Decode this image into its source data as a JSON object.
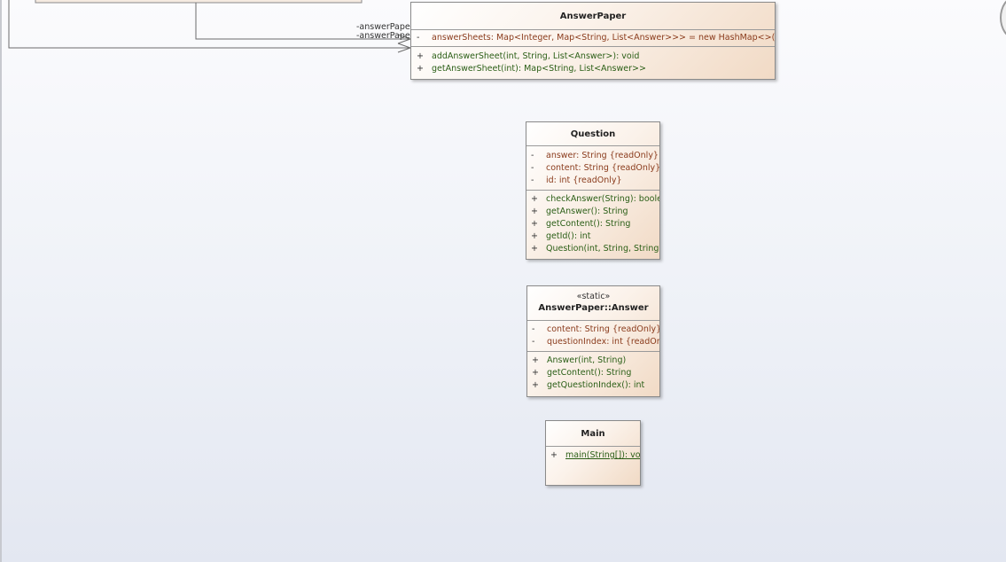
{
  "diagram": {
    "roles": [
      "-answerPaper",
      "-answerPaper"
    ],
    "classes": {
      "answer_paper": {
        "name": "AnswerPaper",
        "attributes": [
          {
            "vis": "-",
            "text": "answerSheets: Map<Integer, Map<String, List<Answer>>> = new HashMap<>() {readOnly}"
          }
        ],
        "operations": [
          {
            "vis": "+",
            "text": "addAnswerSheet(int, String, List<Answer>): void"
          },
          {
            "vis": "+",
            "text": "getAnswerSheet(int): Map<String, List<Answer>>"
          }
        ]
      },
      "question": {
        "name": "Question",
        "attributes": [
          {
            "vis": "-",
            "text": "answer: String {readOnly}"
          },
          {
            "vis": "-",
            "text": "content: String {readOnly}"
          },
          {
            "vis": "-",
            "text": "id: int {readOnly}"
          }
        ],
        "operations": [
          {
            "vis": "+",
            "text": "checkAnswer(String): boolean"
          },
          {
            "vis": "+",
            "text": "getAnswer(): String"
          },
          {
            "vis": "+",
            "text": "getContent(): String"
          },
          {
            "vis": "+",
            "text": "getId(): int"
          },
          {
            "vis": "+",
            "text": "Question(int, String, String)"
          }
        ]
      },
      "answer": {
        "stereotype": "«static»",
        "name": "AnswerPaper::Answer",
        "attributes": [
          {
            "vis": "-",
            "text": "content: String {readOnly}"
          },
          {
            "vis": "-",
            "text": "questionIndex: int {readOnly}"
          }
        ],
        "operations": [
          {
            "vis": "+",
            "text": "Answer(int, String)"
          },
          {
            "vis": "+",
            "text": "getContent(): String"
          },
          {
            "vis": "+",
            "text": "getQuestionIndex(): int"
          }
        ]
      },
      "main": {
        "name": "Main",
        "operations": [
          {
            "vis": "+",
            "text": "main(String[]): void"
          }
        ]
      }
    }
  }
}
